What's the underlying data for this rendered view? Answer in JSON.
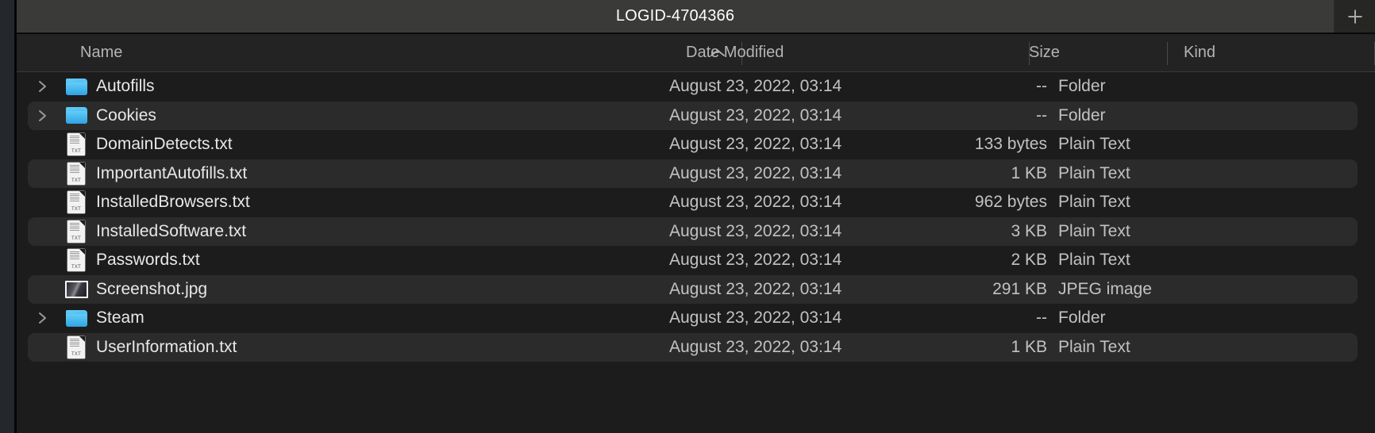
{
  "window": {
    "title": "LOGID-4704366",
    "new_tab_label": "+",
    "new_tab_icon": "plus-icon",
    "background_color": "#1c1c1c",
    "titlebar_color": "#3a3a38"
  },
  "columns": {
    "name": "Name",
    "date_modified": "Date Modified",
    "size": "Size",
    "kind": "Kind",
    "sort_column": "Name",
    "sort_direction_icon": "chevron-up-icon"
  },
  "files": [
    {
      "name": "Autofills",
      "date": "August 23, 2022, 03:14",
      "size": "--",
      "kind": "Folder",
      "icon": "folder-icon",
      "expandable": true,
      "disclosure_icon": "chevron-right-icon"
    },
    {
      "name": "Cookies",
      "date": "August 23, 2022, 03:14",
      "size": "--",
      "kind": "Folder",
      "icon": "folder-icon",
      "expandable": true,
      "disclosure_icon": "chevron-right-icon"
    },
    {
      "name": "DomainDetects.txt",
      "date": "August 23, 2022, 03:14",
      "size": "133 bytes",
      "kind": "Plain Text",
      "icon": "text-file-icon",
      "expandable": false,
      "disclosure_icon": ""
    },
    {
      "name": "ImportantAutofills.txt",
      "date": "August 23, 2022, 03:14",
      "size": "1 KB",
      "kind": "Plain Text",
      "icon": "text-file-icon",
      "expandable": false,
      "disclosure_icon": ""
    },
    {
      "name": "InstalledBrowsers.txt",
      "date": "August 23, 2022, 03:14",
      "size": "962 bytes",
      "kind": "Plain Text",
      "icon": "text-file-icon",
      "expandable": false,
      "disclosure_icon": ""
    },
    {
      "name": "InstalledSoftware.txt",
      "date": "August 23, 2022, 03:14",
      "size": "3 KB",
      "kind": "Plain Text",
      "icon": "text-file-icon",
      "expandable": false,
      "disclosure_icon": ""
    },
    {
      "name": "Passwords.txt",
      "date": "August 23, 2022, 03:14",
      "size": "2 KB",
      "kind": "Plain Text",
      "icon": "text-file-icon",
      "expandable": false,
      "disclosure_icon": ""
    },
    {
      "name": "Screenshot.jpg",
      "date": "August 23, 2022, 03:14",
      "size": "291 KB",
      "kind": "JPEG image",
      "icon": "image-file-icon",
      "expandable": false,
      "disclosure_icon": ""
    },
    {
      "name": "Steam",
      "date": "August 23, 2022, 03:14",
      "size": "--",
      "kind": "Folder",
      "icon": "folder-icon",
      "expandable": true,
      "disclosure_icon": "chevron-right-icon"
    },
    {
      "name": "UserInformation.txt",
      "date": "August 23, 2022, 03:14",
      "size": "1 KB",
      "kind": "Plain Text",
      "icon": "text-file-icon",
      "expandable": false,
      "disclosure_icon": ""
    }
  ]
}
